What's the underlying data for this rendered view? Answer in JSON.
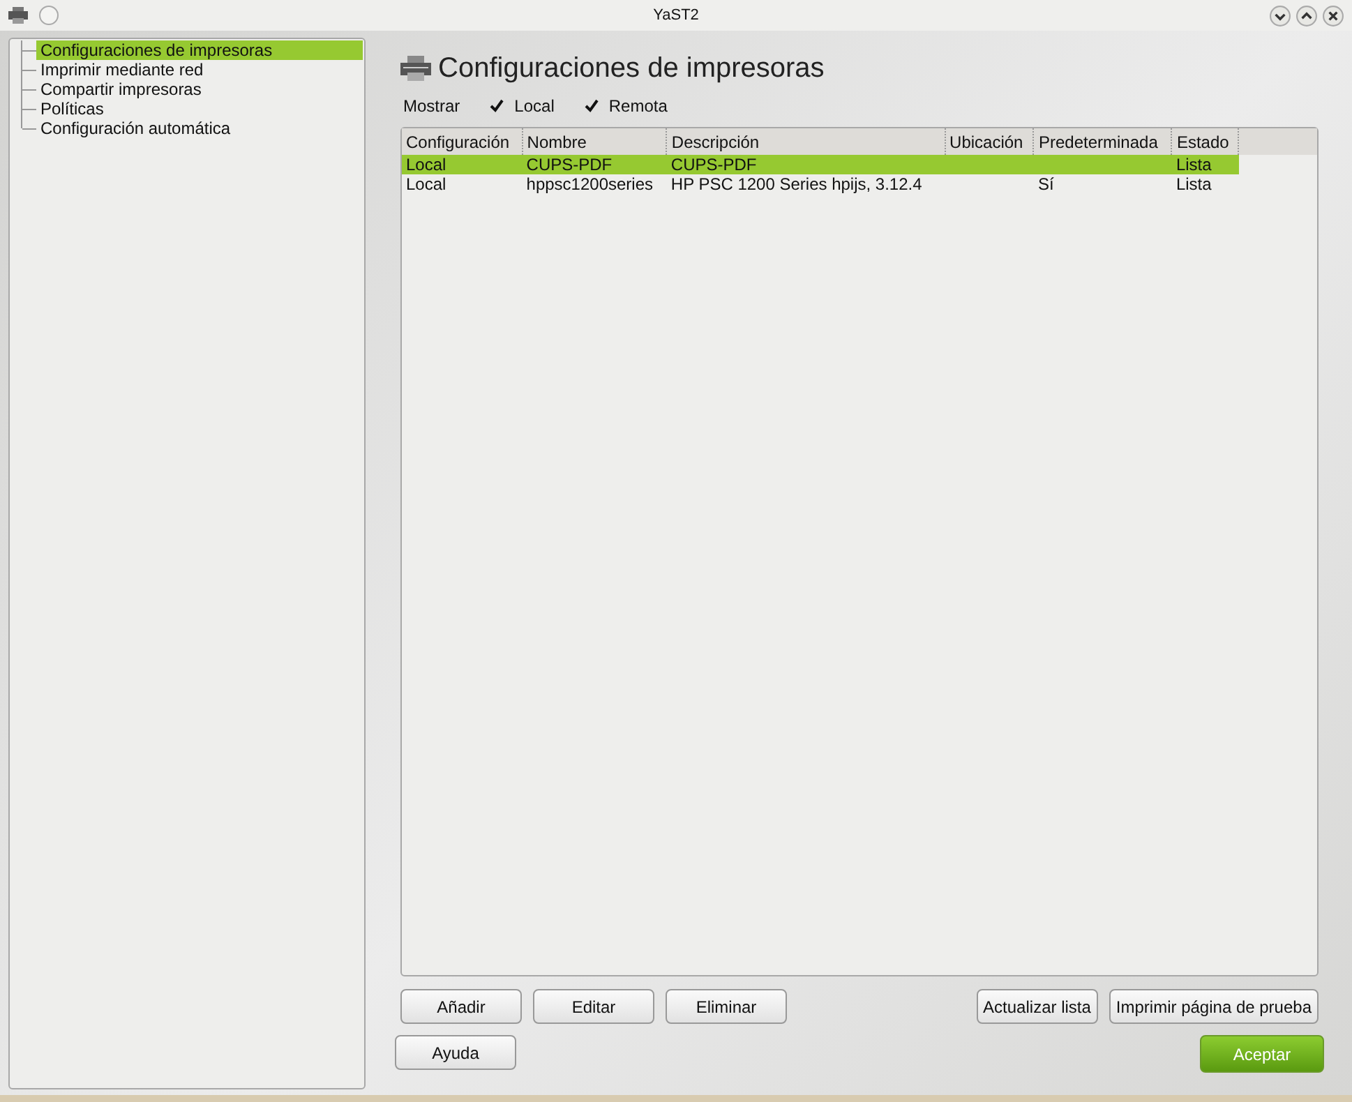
{
  "window": {
    "title": "YaST2"
  },
  "sidebar": {
    "items": [
      {
        "label": "Configuraciones de impresoras",
        "selected": true
      },
      {
        "label": "Imprimir mediante red",
        "selected": false
      },
      {
        "label": "Compartir impresoras",
        "selected": false
      },
      {
        "label": "Políticas",
        "selected": false
      },
      {
        "label": "Configuración automática",
        "selected": false
      }
    ]
  },
  "heading": "Configuraciones de impresoras",
  "filter": {
    "label": "Mostrar",
    "options": [
      {
        "label": "Local",
        "checked": true
      },
      {
        "label": "Remota",
        "checked": true
      }
    ]
  },
  "table": {
    "columns": [
      "Configuración",
      "Nombre",
      "Descripción",
      "Ubicación",
      "Predeterminada",
      "Estado"
    ],
    "rows": [
      {
        "cells": [
          "Local",
          "CUPS-PDF",
          "CUPS-PDF",
          "",
          "",
          "Lista"
        ],
        "selected": true
      },
      {
        "cells": [
          "Local",
          "hppsc1200series",
          "HP PSC 1200 Series hpijs, 3.12.4",
          "",
          "Sí",
          "Lista"
        ],
        "selected": false
      }
    ]
  },
  "table_buttons": [
    {
      "label": "Añadir",
      "kind": "left"
    },
    {
      "label": "Editar",
      "kind": "left"
    },
    {
      "label": "Eliminar",
      "kind": "left"
    },
    {
      "label": "Actualizar lista",
      "kind": "right"
    },
    {
      "label": "Imprimir página de prueba",
      "kind": "right"
    }
  ],
  "bottom_buttons": [
    {
      "label": "Ayuda",
      "kind": "normal"
    },
    {
      "label": "Aceptar",
      "kind": "primary"
    }
  ]
}
